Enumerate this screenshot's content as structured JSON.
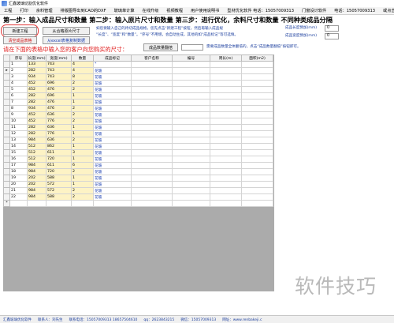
{
  "window": {
    "title": "汇鑫玻璃切割优化软件"
  },
  "menu": [
    "工程",
    "打印",
    "余料管理",
    "排版图导出到CAD的DXF",
    "玻璃单计算",
    "在线升级",
    "视频教程",
    "用户使用说明书",
    "型材优化软件 电话：15057009313",
    "门窗设计软件",
    "电话：15057009313",
    "或点击联系我们"
  ],
  "steps": "第一步：输入成品尺寸和数量 第二步：输入原片尺寸和数量 第三步：进行优化，余料尺寸和数量 不同种类成品分隔",
  "buttons": {
    "new_project": "新建工程",
    "add_original": "从合格原片尺寸",
    "clear_table": "清空成品表格",
    "excel_copy": "从excel表格复制数据",
    "qty_rewrite": "成品数量翻倍"
  },
  "hints": {
    "line1": "如您要输入自己的待切成品规格，您先点击“新建工程”按钮，然后再输入成品规",
    "line2": "“长度”、“宽度”和“数量”。“序号”不用增，会自动生成，其他的如“成品标记”等可选填。",
    "line3": "需要成品数量全体翻倍的，点击“成品数量翻倍”按钮即可。"
  },
  "labels": {
    "length_tol": "成品长度预加(mm)",
    "width_tol": "成品宽度预加(mm)"
  },
  "inputs": {
    "length_tol": "0",
    "width_tol": "0",
    "multiplier": ""
  },
  "prompt": "请在下面的表格中输入您的客户向您购买的尺寸：",
  "table": {
    "columns": [
      "序号",
      "长度(mm)",
      "宽度(mm)",
      "数量",
      "成品标记",
      "客户名称",
      "编号",
      "周长(m)",
      "面积(m2)"
    ],
    "rows": [
      [
        "1",
        "133",
        "743",
        "4",
        "*",
        "",
        "",
        "",
        ""
      ],
      [
        "2",
        "282",
        "743",
        "4",
        "花玻",
        "",
        "",
        "",
        ""
      ],
      [
        "3",
        "934",
        "743",
        "8",
        "花玻",
        "",
        "",
        "",
        ""
      ],
      [
        "4",
        "452",
        "696",
        "2",
        "花玻",
        "",
        "",
        "",
        ""
      ],
      [
        "5",
        "452",
        "476",
        "2",
        "花玻",
        "",
        "",
        "",
        ""
      ],
      [
        "6",
        "282",
        "696",
        "1",
        "花玻",
        "",
        "",
        "",
        ""
      ],
      [
        "7",
        "282",
        "476",
        "1",
        "花玻",
        "",
        "",
        "",
        ""
      ],
      [
        "8",
        "934",
        "476",
        "2",
        "花玻",
        "",
        "",
        "",
        ""
      ],
      [
        "9",
        "452",
        "636",
        "2",
        "花玻",
        "",
        "",
        "",
        ""
      ],
      [
        "10",
        "452",
        "776",
        "2",
        "花玻",
        "",
        "",
        "",
        ""
      ],
      [
        "11",
        "282",
        "636",
        "1",
        "花玻",
        "",
        "",
        "",
        ""
      ],
      [
        "12",
        "282",
        "776",
        "1",
        "花玻",
        "",
        "",
        "",
        ""
      ],
      [
        "13",
        "984",
        "636",
        "2",
        "花玻",
        "",
        "",
        "",
        ""
      ],
      [
        "14",
        "512",
        "862",
        "1",
        "花玻",
        "",
        "",
        "",
        ""
      ],
      [
        "15",
        "512",
        "611",
        "3",
        "花玻",
        "",
        "",
        "",
        ""
      ],
      [
        "16",
        "512",
        "720",
        "1",
        "花玻",
        "",
        "",
        "",
        ""
      ],
      [
        "17",
        "984",
        "611",
        "6",
        "花玻",
        "",
        "",
        "",
        ""
      ],
      [
        "18",
        "984",
        "720",
        "2",
        "花玻",
        "",
        "",
        "",
        ""
      ],
      [
        "19",
        "202",
        "588",
        "1",
        "花玻",
        "",
        "",
        "",
        ""
      ],
      [
        "20",
        "202",
        "572",
        "1",
        "花玻",
        "",
        "",
        "",
        ""
      ],
      [
        "21",
        "984",
        "572",
        "2",
        "花玻",
        "",
        "",
        "",
        ""
      ],
      [
        "22",
        "984",
        "588",
        "2",
        "花玻",
        "",
        "",
        "",
        ""
      ]
    ],
    "current_row_marker": "▸",
    "new_row_marker": "*"
  },
  "status": {
    "app": "汇鑫玻璃优化软件",
    "contact": "联系人：刘先生",
    "phone": "联系电话：15057009313 18657504610",
    "qq": "qq：2623843215",
    "wechat": "微信：15057009313",
    "site": "网址：www.renbakeji.c"
  },
  "watermark": "软件技巧",
  "colors": {
    "accent_red": "#e01c1c",
    "hint_blue": "#1c3f9e",
    "size_col_bg": "#fdf3c5"
  }
}
